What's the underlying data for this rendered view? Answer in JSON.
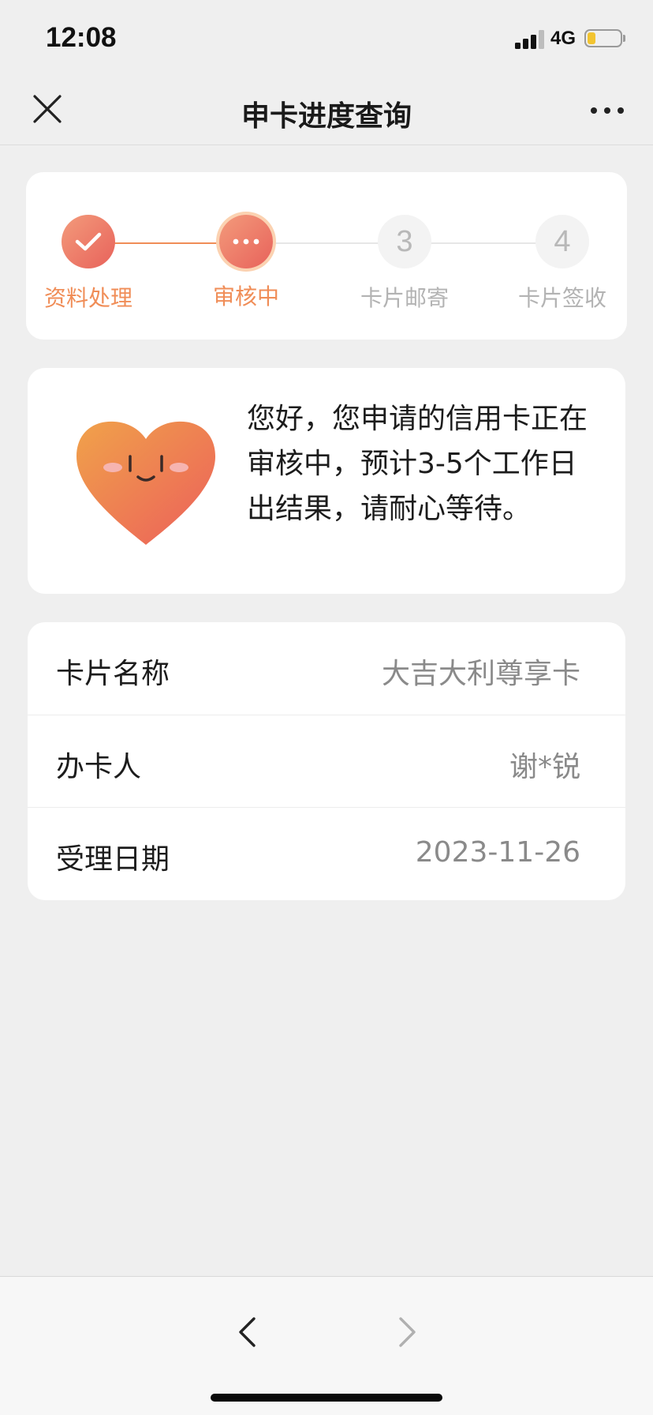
{
  "status_bar": {
    "time": "12:08",
    "network": "4G",
    "signal_icon": "cellular-signal-icon",
    "battery_icon": "battery-icon",
    "battery_color": "#f2c431"
  },
  "nav": {
    "title": "申卡进度查询",
    "close_icon": "close-icon",
    "more_icon": "more-icon"
  },
  "progress": {
    "steps": [
      {
        "label": "资料处理",
        "state": "done",
        "icon": "checkmark-icon"
      },
      {
        "label": "审核中",
        "state": "current",
        "icon": "ellipsis-icon"
      },
      {
        "label": "卡片邮寄",
        "state": "pending",
        "number": "3"
      },
      {
        "label": "卡片签收",
        "state": "pending",
        "number": "4"
      }
    ],
    "active_color": "#f08d57",
    "pending_color": "#b3b3b3"
  },
  "message": {
    "icon": "smiling-heart-icon",
    "text": "您好，您申请的信用卡正在审核中，预计3-5个工作日出结果，请耐心等待。"
  },
  "info": {
    "rows": [
      {
        "label": "卡片名称",
        "value": "大吉大利尊享卡"
      },
      {
        "label": "办卡人",
        "value": "谢*锐"
      },
      {
        "label": "受理日期",
        "value": "2023-11-26"
      }
    ]
  },
  "toolbar": {
    "back_icon": "chevron-left-icon",
    "forward_icon": "chevron-right-icon"
  }
}
